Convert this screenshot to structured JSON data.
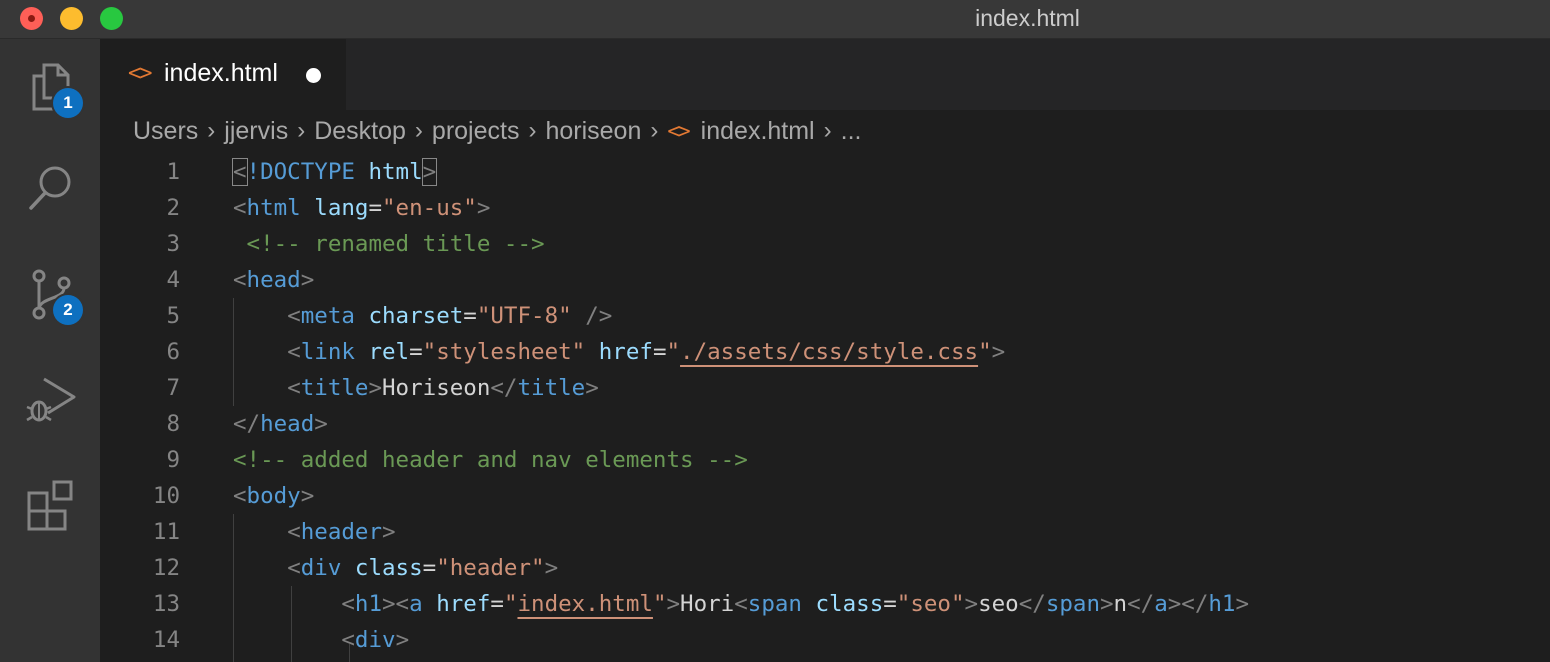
{
  "window": {
    "title": "index.html",
    "traffic_lights": {
      "close": "#fe5f57",
      "minimize": "#fdbc2e",
      "zoom": "#28c840"
    }
  },
  "activity_bar": {
    "items": [
      {
        "name": "explorer",
        "icon": "files-icon",
        "badge": "1"
      },
      {
        "name": "search",
        "icon": "search-icon",
        "badge": ""
      },
      {
        "name": "source-control",
        "icon": "source-control-icon",
        "badge": "2"
      },
      {
        "name": "run-and-debug",
        "icon": "run-debug-icon",
        "badge": ""
      },
      {
        "name": "extensions",
        "icon": "extensions-icon",
        "badge": ""
      }
    ]
  },
  "tabs": [
    {
      "label": "index.html",
      "icon": "<>",
      "modified": true
    }
  ],
  "breadcrumb": {
    "items": [
      "Users",
      "jjervis",
      "Desktop",
      "projects",
      "horiseon"
    ],
    "file_icon": "<>",
    "file": "index.html",
    "more": "..."
  },
  "editor": {
    "lines": [
      {
        "n": "1",
        "tokens": [
          {
            "t": "<",
            "c": "p",
            "hl": true
          },
          {
            "t": "!DOCTYPE",
            "c": "tag"
          },
          {
            "t": " ",
            "c": "txt"
          },
          {
            "t": "html",
            "c": "attr"
          },
          {
            "t": ">",
            "c": "p",
            "hl": true
          }
        ]
      },
      {
        "n": "2",
        "tokens": [
          {
            "t": "<",
            "c": "p"
          },
          {
            "t": "html",
            "c": "tag"
          },
          {
            "t": " ",
            "c": "txt"
          },
          {
            "t": "lang",
            "c": "attr"
          },
          {
            "t": "=",
            "c": "txt"
          },
          {
            "t": "\"en-us\"",
            "c": "str"
          },
          {
            "t": ">",
            "c": "p"
          }
        ]
      },
      {
        "n": "3",
        "tokens": [
          {
            "t": " ",
            "c": "txt"
          },
          {
            "t": "<!-- renamed title -->",
            "c": "cm"
          }
        ]
      },
      {
        "n": "4",
        "tokens": [
          {
            "t": "<",
            "c": "p"
          },
          {
            "t": "head",
            "c": "tag"
          },
          {
            "t": ">",
            "c": "p"
          }
        ]
      },
      {
        "n": "5",
        "tokens": [
          {
            "t": "    ",
            "c": "txt"
          },
          {
            "t": "<",
            "c": "p"
          },
          {
            "t": "meta",
            "c": "tag"
          },
          {
            "t": " ",
            "c": "txt"
          },
          {
            "t": "charset",
            "c": "attr"
          },
          {
            "t": "=",
            "c": "txt"
          },
          {
            "t": "\"UTF-8\"",
            "c": "str"
          },
          {
            "t": " />",
            "c": "p"
          }
        ]
      },
      {
        "n": "6",
        "tokens": [
          {
            "t": "    ",
            "c": "txt"
          },
          {
            "t": "<",
            "c": "p"
          },
          {
            "t": "link",
            "c": "tag"
          },
          {
            "t": " ",
            "c": "txt"
          },
          {
            "t": "rel",
            "c": "attr"
          },
          {
            "t": "=",
            "c": "txt"
          },
          {
            "t": "\"stylesheet\"",
            "c": "str"
          },
          {
            "t": " ",
            "c": "txt"
          },
          {
            "t": "href",
            "c": "attr"
          },
          {
            "t": "=",
            "c": "txt"
          },
          {
            "t": "\"",
            "c": "str"
          },
          {
            "t": "./assets/css/style.css",
            "c": "str",
            "u": true
          },
          {
            "t": "\"",
            "c": "str"
          },
          {
            "t": ">",
            "c": "p"
          }
        ]
      },
      {
        "n": "7",
        "tokens": [
          {
            "t": "    ",
            "c": "txt"
          },
          {
            "t": "<",
            "c": "p"
          },
          {
            "t": "title",
            "c": "tag"
          },
          {
            "t": ">",
            "c": "p"
          },
          {
            "t": "Horiseon",
            "c": "txt"
          },
          {
            "t": "</",
            "c": "p"
          },
          {
            "t": "title",
            "c": "tag"
          },
          {
            "t": ">",
            "c": "p"
          }
        ]
      },
      {
        "n": "8",
        "tokens": [
          {
            "t": "</",
            "c": "p"
          },
          {
            "t": "head",
            "c": "tag"
          },
          {
            "t": ">",
            "c": "p"
          }
        ]
      },
      {
        "n": "9",
        "tokens": [
          {
            "t": "<!-- added header and nav elements -->",
            "c": "cm"
          }
        ]
      },
      {
        "n": "10",
        "tokens": [
          {
            "t": "<",
            "c": "p"
          },
          {
            "t": "body",
            "c": "tag"
          },
          {
            "t": ">",
            "c": "p"
          }
        ]
      },
      {
        "n": "11",
        "tokens": [
          {
            "t": "    ",
            "c": "txt"
          },
          {
            "t": "<",
            "c": "p"
          },
          {
            "t": "header",
            "c": "tag"
          },
          {
            "t": ">",
            "c": "p"
          }
        ]
      },
      {
        "n": "12",
        "tokens": [
          {
            "t": "    ",
            "c": "txt"
          },
          {
            "t": "<",
            "c": "p"
          },
          {
            "t": "div",
            "c": "tag"
          },
          {
            "t": " ",
            "c": "txt"
          },
          {
            "t": "class",
            "c": "attr"
          },
          {
            "t": "=",
            "c": "txt"
          },
          {
            "t": "\"header\"",
            "c": "str"
          },
          {
            "t": ">",
            "c": "p"
          }
        ]
      },
      {
        "n": "13",
        "tokens": [
          {
            "t": "        ",
            "c": "txt"
          },
          {
            "t": "<",
            "c": "p"
          },
          {
            "t": "h1",
            "c": "tag"
          },
          {
            "t": "><",
            "c": "p"
          },
          {
            "t": "a",
            "c": "tag"
          },
          {
            "t": " ",
            "c": "txt"
          },
          {
            "t": "href",
            "c": "attr"
          },
          {
            "t": "=",
            "c": "txt"
          },
          {
            "t": "\"",
            "c": "str"
          },
          {
            "t": "index.html",
            "c": "str",
            "u": true
          },
          {
            "t": "\"",
            "c": "str"
          },
          {
            "t": ">",
            "c": "p"
          },
          {
            "t": "Hori",
            "c": "txt"
          },
          {
            "t": "<",
            "c": "p"
          },
          {
            "t": "span",
            "c": "tag"
          },
          {
            "t": " ",
            "c": "txt"
          },
          {
            "t": "class",
            "c": "attr"
          },
          {
            "t": "=",
            "c": "txt"
          },
          {
            "t": "\"seo\"",
            "c": "str"
          },
          {
            "t": ">",
            "c": "p"
          },
          {
            "t": "seo",
            "c": "txt"
          },
          {
            "t": "</",
            "c": "p"
          },
          {
            "t": "span",
            "c": "tag"
          },
          {
            "t": ">",
            "c": "p"
          },
          {
            "t": "n",
            "c": "txt"
          },
          {
            "t": "</",
            "c": "p"
          },
          {
            "t": "a",
            "c": "tag"
          },
          {
            "t": "></",
            "c": "p"
          },
          {
            "t": "h1",
            "c": "tag"
          },
          {
            "t": ">",
            "c": "p"
          }
        ]
      },
      {
        "n": "14",
        "tokens": [
          {
            "t": "        ",
            "c": "txt"
          },
          {
            "t": "<",
            "c": "p"
          },
          {
            "t": "div",
            "c": "tag"
          },
          {
            "t": ">",
            "c": "p"
          }
        ]
      }
    ]
  }
}
